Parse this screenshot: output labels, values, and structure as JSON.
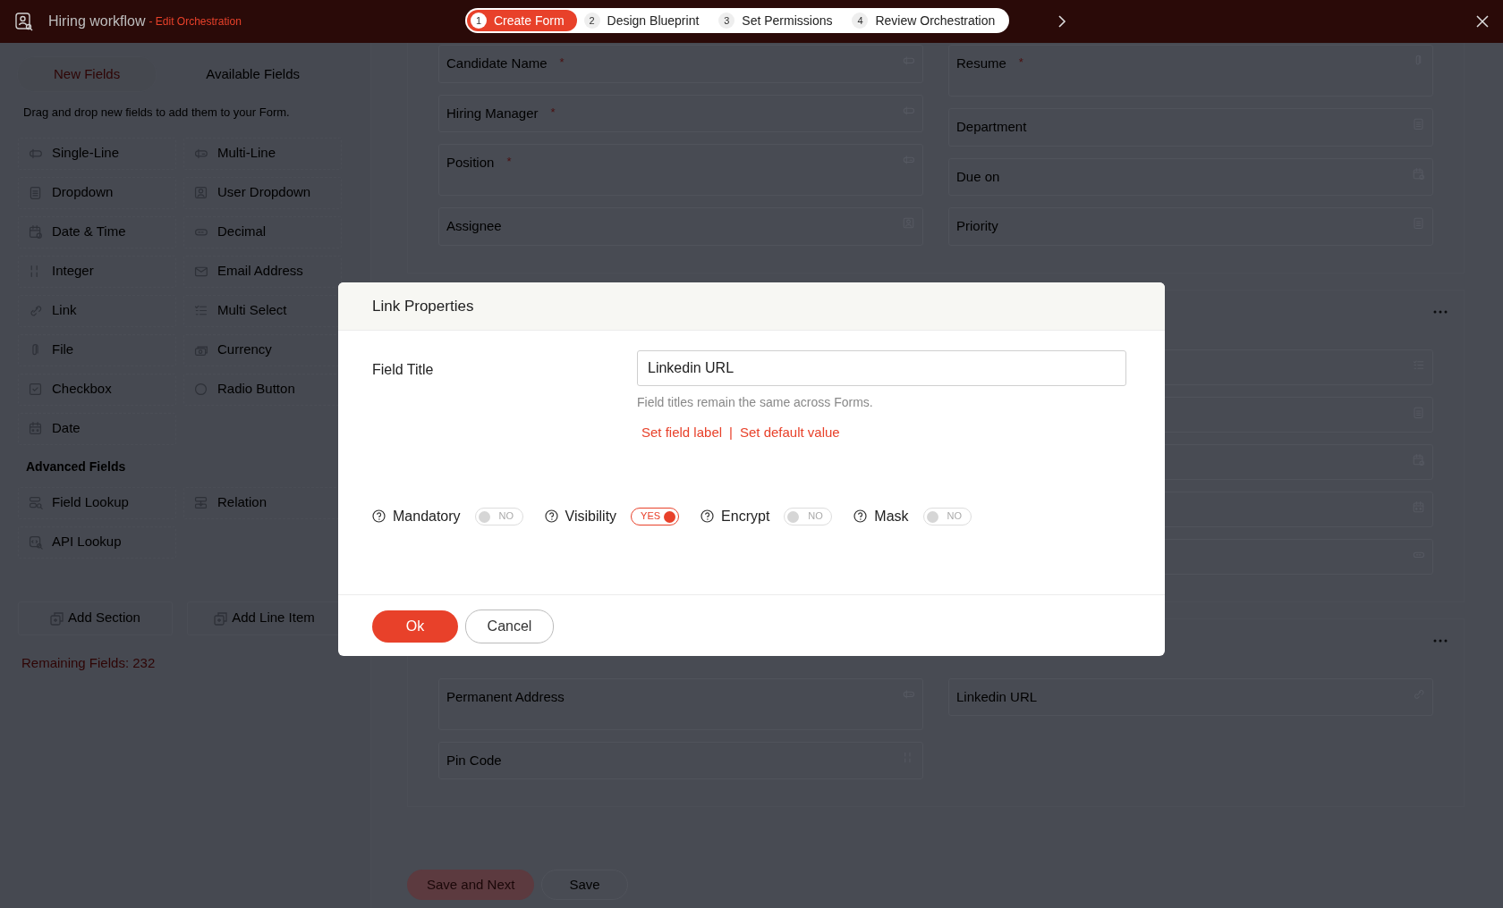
{
  "header": {
    "title": "Hiring workflow",
    "subtitle": "- Edit Orchestration",
    "steps": [
      {
        "number": "1",
        "label": "Create Form",
        "selected": true
      },
      {
        "number": "2",
        "label": "Design Blueprint",
        "selected": false
      },
      {
        "number": "3",
        "label": "Set Permissions",
        "selected": false
      },
      {
        "number": "4",
        "label": "Review Orchestration",
        "selected": false
      }
    ]
  },
  "sidebar": {
    "tabs": [
      {
        "label": "New Fields",
        "selected": true
      },
      {
        "label": "Available Fields",
        "selected": false
      }
    ],
    "hint": "Drag and drop new fields to add them to your Form.",
    "groups": [
      {
        "items": [
          {
            "label": "Single-Line",
            "kind": "single-line"
          },
          {
            "label": "Multi-Line",
            "kind": "multi-line"
          },
          {
            "label": "Dropdown",
            "kind": "dropdown"
          },
          {
            "label": "User Dropdown",
            "kind": "user-dropdown"
          },
          {
            "label": "Date & Time",
            "kind": "date-time"
          },
          {
            "label": "Decimal",
            "kind": "decimal"
          },
          {
            "label": "Integer",
            "kind": "integer"
          },
          {
            "label": "Email Address",
            "kind": "email"
          },
          {
            "label": "Link",
            "kind": "link"
          },
          {
            "label": "Multi Select",
            "kind": "multi-select"
          },
          {
            "label": "File",
            "kind": "file"
          },
          {
            "label": "Currency",
            "kind": "currency"
          },
          {
            "label": "Checkbox",
            "kind": "checkbox"
          },
          {
            "label": "Radio Button",
            "kind": "radio"
          },
          {
            "label": "Date",
            "kind": "date"
          }
        ]
      },
      {
        "heading": "Advanced Fields",
        "items": [
          {
            "label": "Field Lookup",
            "kind": "field-lookup"
          },
          {
            "label": "Relation",
            "kind": "relation"
          },
          {
            "label": "API Lookup",
            "kind": "api-lookup"
          }
        ]
      }
    ],
    "actions": [
      {
        "label": "Add Section"
      },
      {
        "label": "Add Line Item"
      }
    ],
    "remaining": "Remaining Fields: 232"
  },
  "form": {
    "sections": [
      {
        "left": [
          {
            "label": "Candidate Name",
            "mark": "*",
            "kind": "single-line"
          },
          {
            "label": "Hiring Manager",
            "mark": "*",
            "kind": "single-line"
          },
          {
            "label": "Position",
            "mark": "*",
            "kind": "multi-line"
          },
          {
            "label": "Assignee",
            "kind": "user-dropdown"
          }
        ],
        "right": [
          {
            "label": "Resume",
            "mark": "*",
            "kind": "file"
          },
          {
            "label": "Department",
            "kind": "dropdown"
          },
          {
            "label": "Due on",
            "kind": "date-time"
          },
          {
            "label": "Priority",
            "kind": "dropdown"
          }
        ]
      },
      {
        "menu": true,
        "right": [
          {
            "kind": "multi-select"
          },
          {
            "kind": "dropdown"
          },
          {
            "kind": "date-time"
          },
          {
            "kind": "date"
          },
          {
            "kind": "decimal"
          }
        ]
      },
      {
        "menu": true,
        "left": [
          {
            "label": "Permanent Address",
            "kind": "multi-line"
          },
          {
            "label": "Pin Code",
            "kind": "integer"
          }
        ],
        "right": [
          {
            "label": "Linkedin URL",
            "kind": "link"
          }
        ]
      }
    ],
    "buttons": [
      {
        "label": "Save and Next",
        "kind": "primary"
      },
      {
        "label": "Save",
        "kind": "secondary"
      }
    ]
  },
  "dialog": {
    "title": "Link Properties",
    "field_label": "Field Title",
    "field_value": "Linkedin URL",
    "help": "Field titles remain the same across Forms.",
    "links": [
      "Set field label",
      "Set default value"
    ],
    "separator": "|",
    "toggles": [
      {
        "label": "Mandatory",
        "on": false,
        "text": "NO"
      },
      {
        "label": "Visibility",
        "on": true,
        "text": "YES"
      },
      {
        "label": "Encrypt",
        "on": false,
        "text": "NO"
      },
      {
        "label": "Mask",
        "on": false,
        "text": "NO"
      }
    ],
    "buttons": [
      {
        "label": "Ok",
        "kind": "primary"
      },
      {
        "label": "Cancel",
        "kind": "secondary"
      }
    ]
  }
}
